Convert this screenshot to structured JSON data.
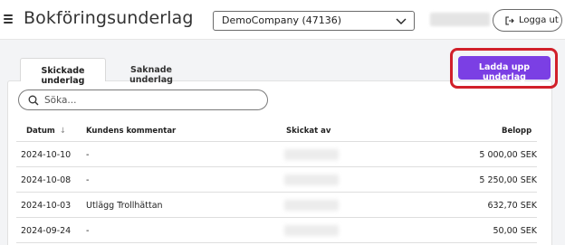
{
  "header": {
    "title": "Bokföringsunderlag",
    "company": "DemoCompany (47136)",
    "logout_label": "Logga ut"
  },
  "tabs": [
    {
      "label": "Skickade underlag",
      "active": true
    },
    {
      "label": "Saknade underlag",
      "active": false
    }
  ],
  "upload_label": "Ladda upp underlag",
  "search": {
    "placeholder": "Söka..."
  },
  "table": {
    "columns": {
      "date": "Datum",
      "comment": "Kundens kommentar",
      "sent_by": "Skickat av",
      "amount": "Belopp"
    },
    "rows": [
      {
        "date": "2024-10-10",
        "comment": "-",
        "amount": "5 000,00 SEK"
      },
      {
        "date": "2024-10-08",
        "comment": "-",
        "amount": "5 250,00 SEK"
      },
      {
        "date": "2024-10-03",
        "comment": "Utlägg Trollhättan",
        "amount": "632,70 SEK"
      },
      {
        "date": "2024-09-24",
        "comment": "-",
        "amount": "50,00 SEK"
      }
    ]
  },
  "colors": {
    "accent": "#7b3fe4",
    "highlight": "#d1202a"
  }
}
